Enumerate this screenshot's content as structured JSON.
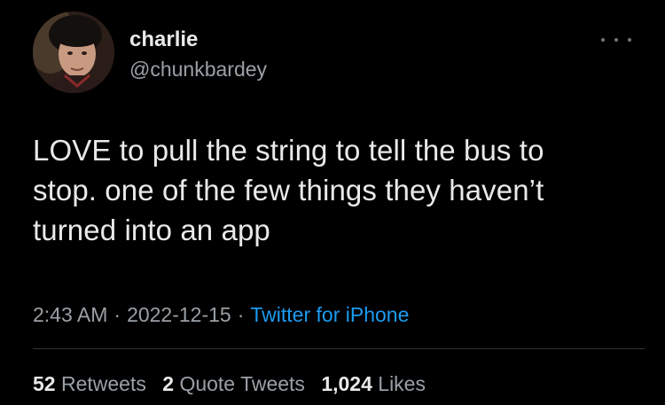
{
  "user": {
    "display_name": "charlie",
    "handle": "@chunkbardey",
    "avatar": "profile-photo"
  },
  "tweet": {
    "text_line1": "LOVE to pull the string to tell the bus to",
    "text_line2": "stop. one of the few things they haven’t",
    "text_line3": "turned into an app"
  },
  "meta": {
    "time": "2:43 AM",
    "separator": "·",
    "date": "2022-12-15",
    "source": "Twitter for iPhone"
  },
  "stats": {
    "retweets_count": "52",
    "retweets_label": "Retweets",
    "quotes_count": "2",
    "quotes_label": "Quote Tweets",
    "likes_count": "1,024",
    "likes_label": "Likes"
  },
  "colors": {
    "background": "#000000",
    "text": "#e7e9ea",
    "secondary": "#9aa0a6",
    "link": "#1d9bf0"
  }
}
